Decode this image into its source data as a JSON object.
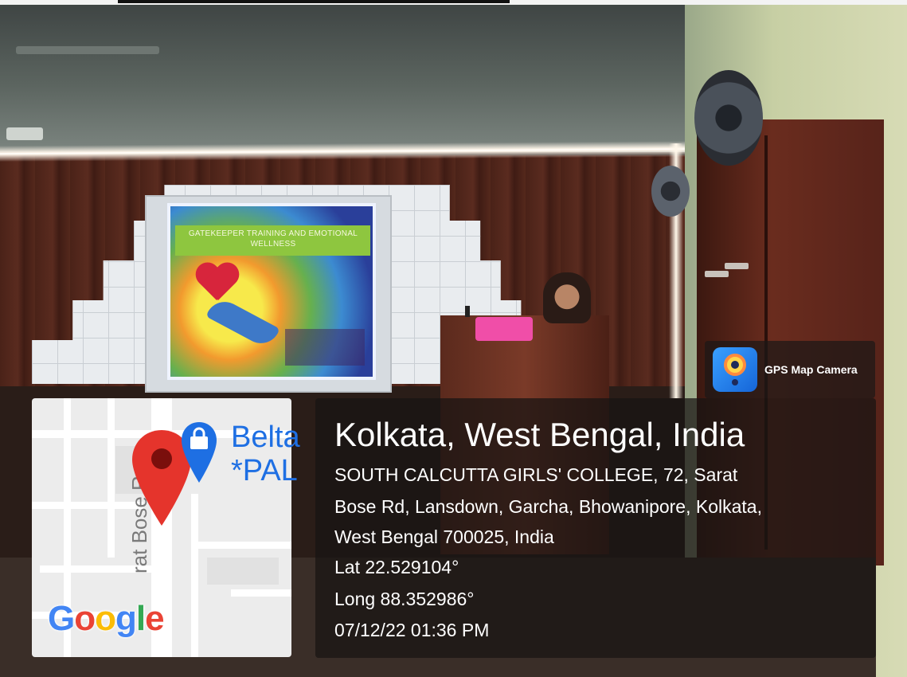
{
  "slide": {
    "title": "GATEKEEPER TRAINING AND EMOTIONAL WELLNESS"
  },
  "map": {
    "road_label": "rat Bose R",
    "poi_line1": "Belta",
    "poi_line2": "*PAL",
    "logo_letters": [
      "G",
      "o",
      "o",
      "g",
      "l",
      "e"
    ]
  },
  "badge": {
    "app_name": "GPS Map Camera",
    "icon": "gps-map-camera-icon"
  },
  "location": {
    "title": "Kolkata, West Bengal, India",
    "address_lines": [
      "SOUTH CALCUTTA GIRLS' COLLEGE, 72, Sarat",
      "Bose Rd, Lansdown, Garcha, Bhowanipore, Kolkata,",
      "West Bengal 700025, India"
    ],
    "lat": "Lat 22.529104°",
    "long": "Long 88.352986°",
    "timestamp": "07/12/22 01:36 PM"
  },
  "colors": {
    "pin_red": "#e5342c",
    "poi_blue": "#1e6fe3",
    "card_bg": "rgba(24,20,19,0.74)",
    "slide_band": "#8ec63f"
  }
}
